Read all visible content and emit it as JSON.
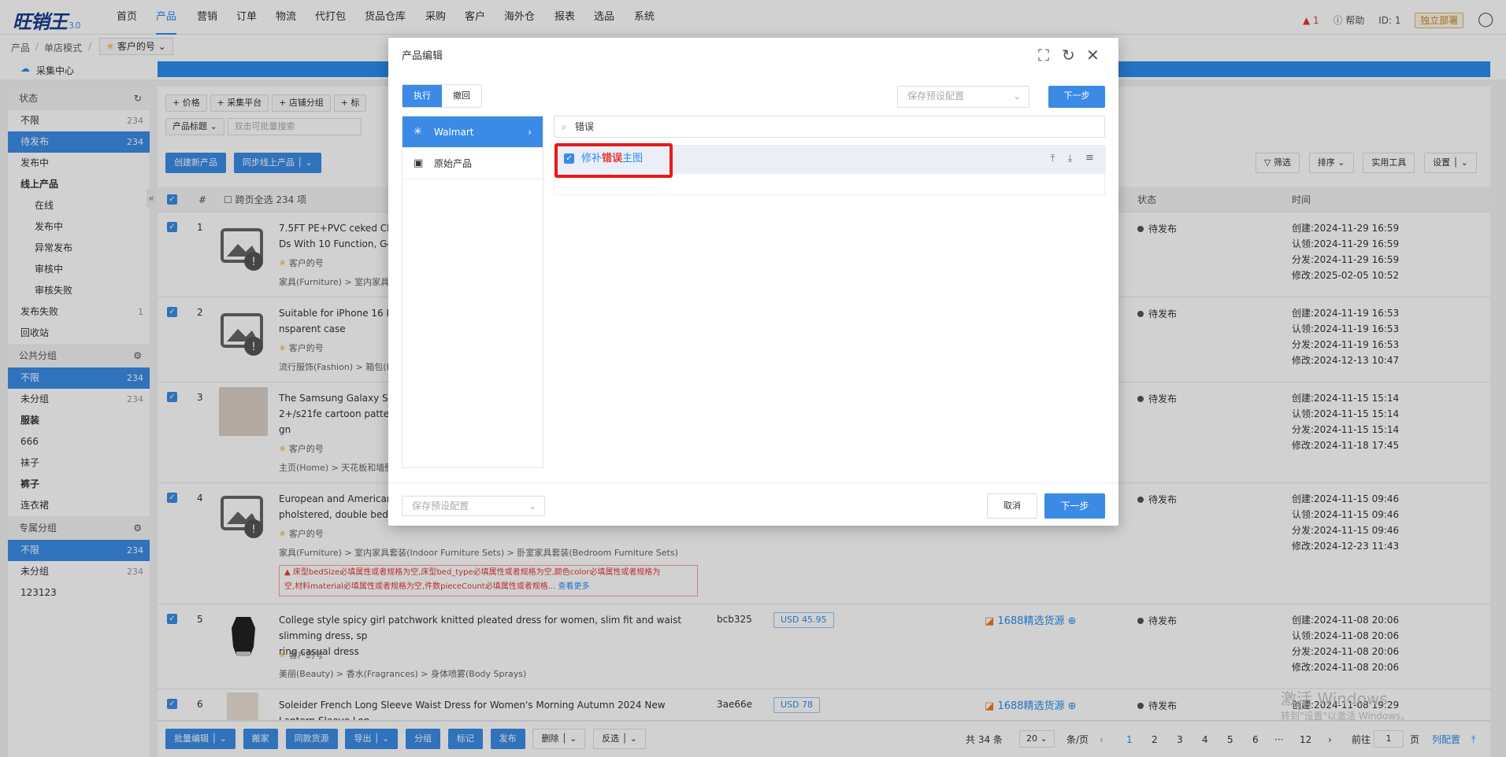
{
  "app": {
    "logo": "旺销王",
    "version": "3.0"
  },
  "topnav": {
    "items": [
      "首页",
      "产品",
      "营销",
      "订单",
      "物流",
      "代打包",
      "货品仓库",
      "采购",
      "客户",
      "海外仓",
      "报表",
      "选品",
      "系统"
    ],
    "active": "产品",
    "alert_count": "1",
    "help": "帮助",
    "id_label": "ID: 1",
    "deploy": "独立部署"
  },
  "breadcrumb": {
    "items": [
      "产品",
      "单店模式"
    ],
    "shop": "客户的号"
  },
  "collect_center": "采集中心",
  "sidebar": {
    "status_title": "状态",
    "status_items": [
      {
        "label": "不限",
        "count": "234"
      },
      {
        "label": "待发布",
        "count": "234"
      },
      {
        "label": "发布中",
        "count": ""
      },
      {
        "label": "线上产品",
        "count": ""
      },
      {
        "label": "在线",
        "count": ""
      },
      {
        "label": "发布中",
        "count": ""
      },
      {
        "label": "异常发布",
        "count": ""
      },
      {
        "label": "审核中",
        "count": ""
      },
      {
        "label": "审核失败",
        "count": ""
      },
      {
        "label": "发布失败",
        "count": "1"
      },
      {
        "label": "回收站",
        "count": ""
      }
    ],
    "public_title": "公共分组",
    "public_items": [
      {
        "label": "不限",
        "count": "234"
      },
      {
        "label": "未分组",
        "count": "234"
      },
      {
        "label": "服装",
        "count": ""
      },
      {
        "label": "666",
        "count": ""
      },
      {
        "label": "袜子",
        "count": ""
      },
      {
        "label": "裤子",
        "count": ""
      },
      {
        "label": "连衣裙",
        "count": ""
      }
    ],
    "private_title": "专属分组",
    "private_items": [
      {
        "label": "不限",
        "count": "234"
      },
      {
        "label": "未分组",
        "count": "234"
      },
      {
        "label": "123123",
        "count": ""
      }
    ]
  },
  "filters": {
    "tags": [
      "价格",
      "采集平台",
      "店铺分组",
      "标"
    ],
    "field": "产品标题",
    "placeholder": "双击可批量搜索"
  },
  "actions": {
    "create": "创建新产品",
    "sync": "同步线上产品",
    "filter": "筛选",
    "sort": "排序",
    "tools": "实用工具",
    "settings": "设置"
  },
  "table": {
    "headers": {
      "num": "#",
      "select_all": "跨页全选 234 项",
      "status": "状态",
      "time": "时间"
    },
    "rows": [
      {
        "n": "1",
        "title": "7.5FT PE+PVC ceked Chri",
        "title2": "Ds With 10 Function, G45 I",
        "shop": "客户的号",
        "cat": "家具(Furniture) > 室内家具套",
        "status": "待发布",
        "t": [
          "创建:2024-11-29 16:59",
          "认领:2024-11-29 16:59",
          "分发:2024-11-29 16:59",
          "修改:2025-02-05 10:52"
        ]
      },
      {
        "n": "2",
        "title": "Suitable for iPhone 16 Pror",
        "title2": "nsparent case",
        "shop": "客户的号",
        "cat": "流行服饰(Fashion) > 箱包(Ba",
        "status": "待发布",
        "t": [
          "创建:2024-11-19 16:53",
          "认领:2024-11-19 16:53",
          "分发:2024-11-19 16:53",
          "修改:2024-12-13 10:47"
        ]
      },
      {
        "n": "3",
        "title": "The Samsung Galaxy S24",
        "title2": "2+/s21fe cartoon pattern pl",
        "title3": "gn",
        "shop": "客户的号",
        "cat": "主页(Home) > 天花板和墙壁",
        "status": "待发布",
        "t": [
          "创建:2024-11-15 15:14",
          "认领:2024-11-15 15:14",
          "分发:2024-11-15 15:14",
          "修改:2024-11-18 17:45"
        ]
      },
      {
        "n": "4",
        "title": "European and American st",
        "title2": "pholstered, double bed, co",
        "shop": "客户的号",
        "cat": "家具(Furniture) > 室内家具套装(Indoor Furniture Sets) > 卧室家具套装(Bedroom Furniture Sets)",
        "err1": "床型bedSize必填属性或者规格为空,床型bed_type必填属性或者规格为空,颜色color必填属性或者规格为",
        "err2": "空,材料material必填属性或者规格为空,件数pieceCount必填属性或者规格...",
        "more": "查看更多",
        "status": "待发布",
        "t": [
          "创建:2024-11-15 09:46",
          "认领:2024-11-15 09:46",
          "分发:2024-11-15 09:46",
          "修改:2024-12-23 11:43"
        ]
      },
      {
        "n": "5",
        "title": "College style spicy girl patchwork knitted pleated dress for women, slim fit and waist slimming dress, sp",
        "title2": "ring casual dress",
        "shop": "客户的号",
        "cat": "美丽(Beauty) > 香水(Fragrances) > 身体喷雾(Body Sprays)",
        "sku": "bcb325",
        "price": "USD  45.95",
        "source": "1688精选货源",
        "status": "待发布",
        "t": [
          "创建:2024-11-08 20:06",
          "认领:2024-11-08 20:06",
          "分发:2024-11-08 20:06",
          "修改:2024-11-08 20:06"
        ]
      },
      {
        "n": "6",
        "title": "Soleider French Long Sleeve Waist Dress for Women's Morning Autumn 2024 New Lantern Sleeve Lon",
        "sku": "3ae66e",
        "price": "USD  78",
        "source": "1688精选货源",
        "status": "待发布",
        "t": [
          "创建:2024-11-08 19:29"
        ]
      }
    ]
  },
  "footer": {
    "buttons": [
      "批量编辑",
      "搬家",
      "同款货源",
      "导出",
      "分组",
      "标记",
      "发布",
      "删除",
      "反选"
    ],
    "total": "共 34 条",
    "page_size": "20",
    "per_page": "条/页",
    "pages": [
      "1",
      "2",
      "3",
      "4",
      "5",
      "6",
      "···",
      "12"
    ],
    "goto": "前往",
    "page_input": "1",
    "page_unit": "页",
    "col_config": "列配置"
  },
  "modal": {
    "title": "产品编辑",
    "tab_exec": "执行",
    "tab_undo": "撤回",
    "preset_placeholder": "保存预设配置",
    "next": "下一步",
    "platforms": [
      "Walmart",
      "原始产品"
    ],
    "search_value": "错误",
    "item_prefix": "修补",
    "item_highlight": "错误",
    "item_suffix": "主图",
    "cancel": "取消"
  },
  "watermark": {
    "line1": "激活 Windows",
    "line2": "转到\"设置\"以激活 Windows。"
  },
  "colors": {
    "primary": "#3b8be6",
    "error": "#e53935",
    "highlight_frame": "#e81a1a"
  }
}
